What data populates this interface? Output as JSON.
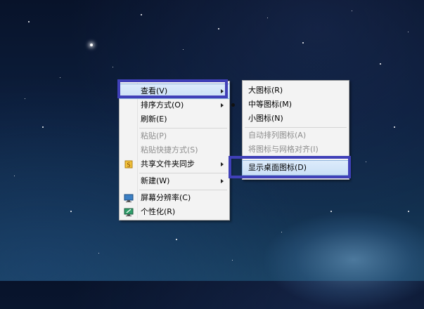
{
  "context_menu": {
    "items": [
      {
        "label": "查看(V)"
      },
      {
        "label": "排序方式(O)"
      },
      {
        "label": "刷新(E)"
      },
      {
        "label": "粘贴(P)"
      },
      {
        "label": "粘贴快捷方式(S)"
      },
      {
        "label": "共享文件夹同步"
      },
      {
        "label": "新建(W)"
      },
      {
        "label": "屏幕分辨率(C)"
      },
      {
        "label": "个性化(R)"
      }
    ]
  },
  "view_submenu": {
    "items": [
      {
        "label": "大图标(R)"
      },
      {
        "label": "中等图标(M)",
        "selected": true
      },
      {
        "label": "小图标(N)"
      },
      {
        "label": "自动排列图标(A)"
      },
      {
        "label": "将图标与网格对齐(I)"
      },
      {
        "label": "显示桌面图标(D)"
      }
    ]
  },
  "colors": {
    "annotation_box": "#4040b8",
    "menu_background": "#f3f3f3",
    "highlight": "#cbe0f6"
  }
}
